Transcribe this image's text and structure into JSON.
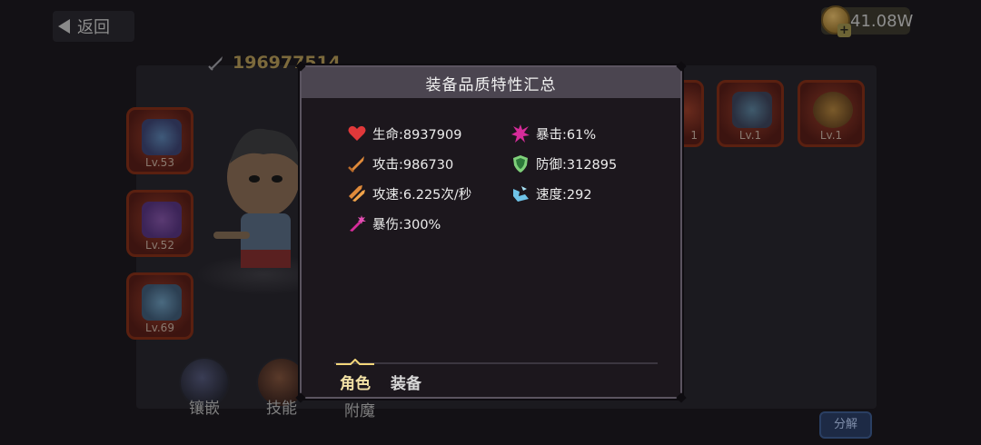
{
  "header": {
    "back_label": "返回",
    "currency": "41.08W",
    "power": "196977514"
  },
  "left_slots": [
    {
      "level": "Lv.53",
      "icon": "wizard-hat-icon"
    },
    {
      "level": "Lv.52",
      "icon": "cape-armor-icon"
    },
    {
      "level": "Lv.69",
      "icon": "boots-icon"
    }
  ],
  "right_slots": [
    {
      "level": "Lv.1",
      "icon": "wand-icon"
    },
    {
      "level": "Lv.1",
      "icon": "ring-icon"
    }
  ],
  "bottom_buttons": {
    "inlay": "镶嵌",
    "skill": "技能",
    "enchant": "附魔"
  },
  "decompose_label": "分解",
  "modal": {
    "title": "装备品质特性汇总",
    "stats": [
      {
        "label": "生命:8937909",
        "icon": "heart-icon"
      },
      {
        "label": "暴击:61%",
        "icon": "crit-burst-icon"
      },
      {
        "label": "攻击:986730",
        "icon": "sword-icon"
      },
      {
        "label": "防御:312895",
        "icon": "shield-icon"
      },
      {
        "label": "攻速:6.225次/秒",
        "icon": "double-sword-icon"
      },
      {
        "label": "速度:292",
        "icon": "wing-boot-icon"
      },
      {
        "label": "暴伤:300%",
        "icon": "crit-damage-icon"
      }
    ],
    "tabs": [
      "角色",
      "装备"
    ],
    "active_tab": "角色"
  },
  "colors": {
    "modal_bg": "#1c171d",
    "modal_header": "#4b4550",
    "active_tab": "#f3e2a6",
    "heart": "#e0383a",
    "crit": "#d62c9a"
  }
}
